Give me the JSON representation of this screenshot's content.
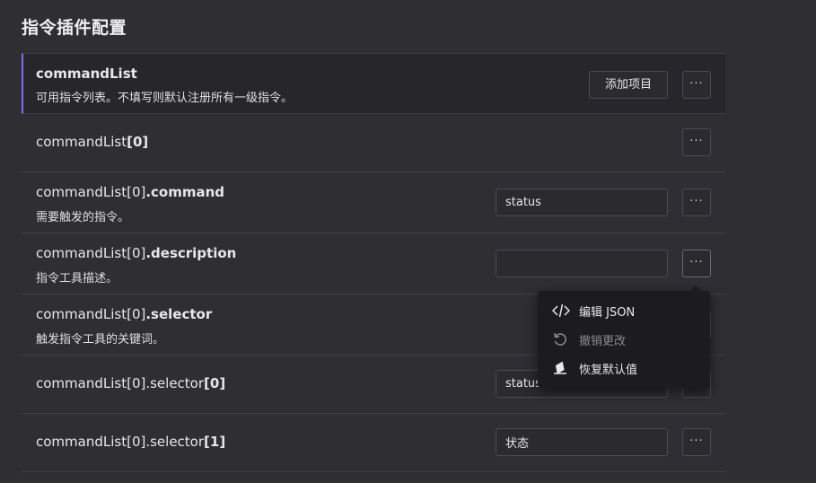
{
  "page_title": "指令插件配置",
  "add_button_label": "添加项目",
  "more_button_label": "···",
  "rows": [
    {
      "title_prefix": "",
      "title_bold": "commandList",
      "desc": "可用指令列表。不填写则默认注册所有一级指令。"
    },
    {
      "title_prefix": "commandList",
      "title_bold": "[0]",
      "desc": ""
    },
    {
      "title_prefix": "commandList[0]",
      "title_bold": ".command",
      "desc": "需要触发的指令。",
      "value": "status"
    },
    {
      "title_prefix": "commandList[0]",
      "title_bold": ".description",
      "desc": "指令工具描述。",
      "value": ""
    },
    {
      "title_prefix": "commandList[0]",
      "title_bold": ".selector",
      "desc": "触发指令工具的关键词。"
    },
    {
      "title_prefix": "commandList[0].selector",
      "title_bold": "[0]",
      "desc": "",
      "value": "status"
    },
    {
      "title_prefix": "commandList[0].selector",
      "title_bold": "[1]",
      "desc": "",
      "value": "状态"
    }
  ],
  "menu": {
    "items": [
      {
        "label": "编辑 JSON",
        "icon": "code-icon",
        "disabled": false
      },
      {
        "label": "撤销更改",
        "icon": "undo-icon",
        "disabled": true
      },
      {
        "label": "恢复默认值",
        "icon": "eraser-icon",
        "disabled": false
      }
    ]
  },
  "colors": {
    "background": "#2e2e33",
    "header_background": "#27272b",
    "accent": "#7c6cf0",
    "menu_background": "#1c1c1f"
  }
}
